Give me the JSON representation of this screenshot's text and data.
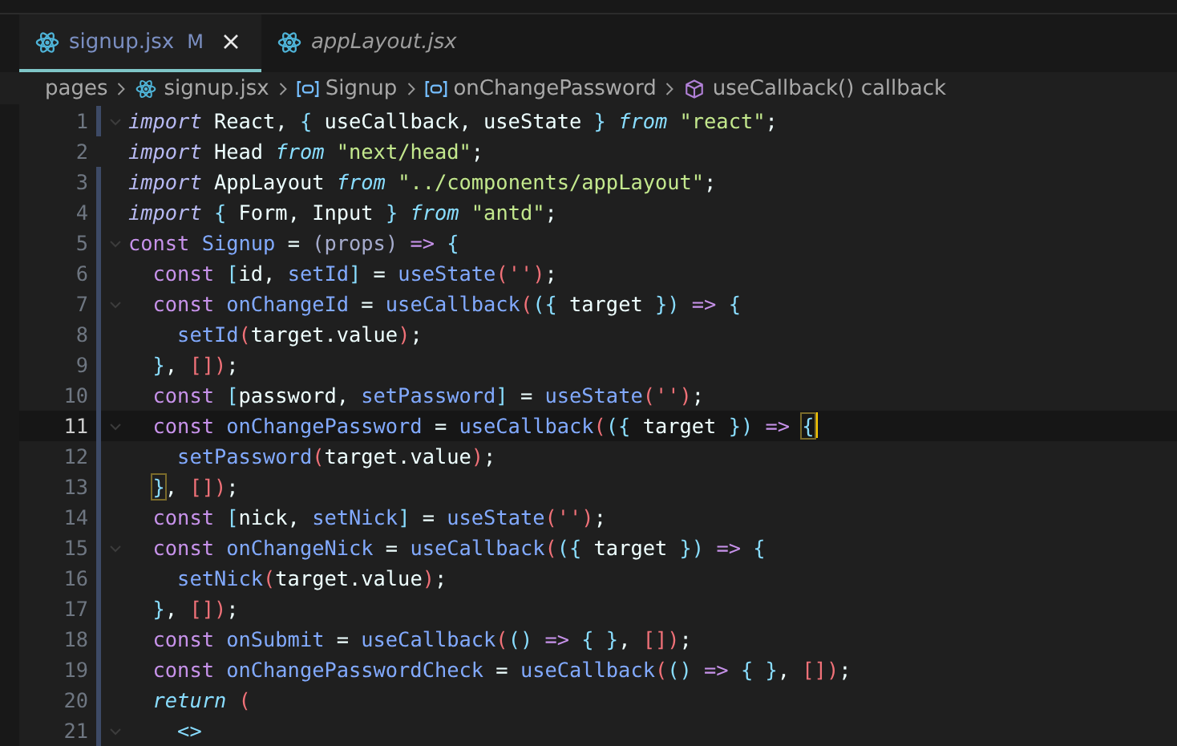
{
  "tabs": [
    {
      "label": "signup.jsx",
      "badge": "M",
      "selected": true,
      "preview": false
    },
    {
      "label": "appLayout.jsx",
      "selected": false,
      "preview": true
    }
  ],
  "breadcrumb": [
    {
      "kind": "folder",
      "label": "pages"
    },
    {
      "kind": "file",
      "label": "signup.jsx"
    },
    {
      "kind": "variable",
      "label": "Signup"
    },
    {
      "kind": "variable",
      "label": "onChangePassword"
    },
    {
      "kind": "method",
      "label": "useCallback() callback"
    }
  ],
  "lines": [
    {
      "number": "1",
      "current": false,
      "modified": true,
      "foldable": true,
      "cursor": false,
      "tokens": [
        {
          "kind": "module",
          "text": "import"
        },
        {
          "kind": "plain",
          "text": " React, "
        },
        {
          "kind": "b1",
          "text": "{"
        },
        {
          "kind": "plain",
          "text": " useCallback, useState "
        },
        {
          "kind": "b1",
          "text": "} "
        },
        {
          "kind": "control",
          "text": "from "
        },
        {
          "kind": "str",
          "text": "\"react\""
        },
        {
          "kind": "plain",
          "text": ";"
        }
      ]
    },
    {
      "number": "2",
      "current": false,
      "modified": false,
      "foldable": false,
      "cursor": false,
      "tokens": [
        {
          "kind": "module",
          "text": "import"
        },
        {
          "kind": "plain",
          "text": " Head "
        },
        {
          "kind": "control",
          "text": "from "
        },
        {
          "kind": "str",
          "text": "\"next/head\""
        },
        {
          "kind": "plain",
          "text": ";"
        }
      ]
    },
    {
      "number": "3",
      "current": false,
      "modified": true,
      "foldable": false,
      "cursor": false,
      "tokens": [
        {
          "kind": "module",
          "text": "import"
        },
        {
          "kind": "plain",
          "text": " AppLayout "
        },
        {
          "kind": "control",
          "text": "from "
        },
        {
          "kind": "str",
          "text": "\"../components/appLayout\""
        },
        {
          "kind": "plain",
          "text": ";"
        }
      ]
    },
    {
      "number": "4",
      "current": false,
      "modified": true,
      "foldable": false,
      "cursor": false,
      "tokens": [
        {
          "kind": "module",
          "text": "import "
        },
        {
          "kind": "b1",
          "text": "{"
        },
        {
          "kind": "plain",
          "text": " Form, Input "
        },
        {
          "kind": "b1",
          "text": "} "
        },
        {
          "kind": "control",
          "text": "from "
        },
        {
          "kind": "str",
          "text": "\"antd\""
        },
        {
          "kind": "plain",
          "text": ";"
        }
      ]
    },
    {
      "number": "5",
      "current": false,
      "modified": true,
      "foldable": true,
      "cursor": false,
      "tokens": [
        {
          "kind": "storage",
          "text": "const "
        },
        {
          "kind": "func",
          "text": "Signup"
        },
        {
          "kind": "plain",
          "text": " = "
        },
        {
          "kind": "param",
          "text": "(props) "
        },
        {
          "kind": "arrow",
          "text": "=> "
        },
        {
          "kind": "b1",
          "text": "{"
        }
      ]
    },
    {
      "number": "6",
      "current": false,
      "modified": true,
      "foldable": false,
      "cursor": false,
      "tokens": [
        {
          "kind": "storage",
          "text": "  const "
        },
        {
          "kind": "b1",
          "text": "["
        },
        {
          "kind": "plain",
          "text": "id, "
        },
        {
          "kind": "func",
          "text": "setId"
        },
        {
          "kind": "b1",
          "text": "]"
        },
        {
          "kind": "plain",
          "text": " = "
        },
        {
          "kind": "func",
          "text": "useState"
        },
        {
          "kind": "b2",
          "text": "('')"
        },
        {
          "kind": "plain",
          "text": ";"
        }
      ]
    },
    {
      "number": "7",
      "current": false,
      "modified": true,
      "foldable": true,
      "cursor": false,
      "tokens": [
        {
          "kind": "storage",
          "text": "  const "
        },
        {
          "kind": "func",
          "text": "onChangeId"
        },
        {
          "kind": "plain",
          "text": " = "
        },
        {
          "kind": "func",
          "text": "useCallback"
        },
        {
          "kind": "b2",
          "text": "("
        },
        {
          "kind": "b1",
          "text": "({"
        },
        {
          "kind": "plain",
          "text": " target "
        },
        {
          "kind": "b1",
          "text": "}) "
        },
        {
          "kind": "arrow",
          "text": "=> "
        },
        {
          "kind": "b1",
          "text": "{"
        }
      ]
    },
    {
      "number": "8",
      "current": false,
      "modified": true,
      "foldable": false,
      "cursor": false,
      "tokens": [
        {
          "kind": "func",
          "text": "    setId"
        },
        {
          "kind": "b2",
          "text": "("
        },
        {
          "kind": "plain",
          "text": "target.value"
        },
        {
          "kind": "b2",
          "text": ")"
        },
        {
          "kind": "plain",
          "text": ";"
        }
      ]
    },
    {
      "number": "9",
      "current": false,
      "modified": true,
      "foldable": false,
      "cursor": false,
      "tokens": [
        {
          "kind": "b1",
          "text": "  }"
        },
        {
          "kind": "plain",
          "text": ", "
        },
        {
          "kind": "b2",
          "text": "[])"
        },
        {
          "kind": "plain",
          "text": ";"
        }
      ]
    },
    {
      "number": "10",
      "current": false,
      "modified": true,
      "foldable": false,
      "cursor": false,
      "tokens": [
        {
          "kind": "storage",
          "text": "  const "
        },
        {
          "kind": "b1",
          "text": "["
        },
        {
          "kind": "plain",
          "text": "password, "
        },
        {
          "kind": "func",
          "text": "setPassword"
        },
        {
          "kind": "b1",
          "text": "]"
        },
        {
          "kind": "plain",
          "text": " = "
        },
        {
          "kind": "func",
          "text": "useState"
        },
        {
          "kind": "b2",
          "text": "('')"
        },
        {
          "kind": "plain",
          "text": ";"
        }
      ]
    },
    {
      "number": "11",
      "current": true,
      "modified": true,
      "foldable": true,
      "cursor": true,
      "tokens": [
        {
          "kind": "storage",
          "text": "  const "
        },
        {
          "kind": "func",
          "text": "onChangePassword"
        },
        {
          "kind": "plain",
          "text": " = "
        },
        {
          "kind": "func",
          "text": "useCallback"
        },
        {
          "kind": "b2",
          "text": "("
        },
        {
          "kind": "b1",
          "text": "({"
        },
        {
          "kind": "plain",
          "text": " target "
        },
        {
          "kind": "b1",
          "text": "}) "
        },
        {
          "kind": "arrow",
          "text": "=> "
        },
        {
          "kind": "match",
          "text": "{"
        }
      ]
    },
    {
      "number": "12",
      "current": false,
      "modified": true,
      "foldable": false,
      "cursor": false,
      "tokens": [
        {
          "kind": "func",
          "text": "    setPassword"
        },
        {
          "kind": "b2",
          "text": "("
        },
        {
          "kind": "plain",
          "text": "target.value"
        },
        {
          "kind": "b2",
          "text": ")"
        },
        {
          "kind": "plain",
          "text": ";"
        }
      ]
    },
    {
      "number": "13",
      "current": false,
      "modified": true,
      "foldable": false,
      "cursor": false,
      "tokens": [
        {
          "kind": "match",
          "text": "  }"
        },
        {
          "kind": "plain",
          "text": ", "
        },
        {
          "kind": "b2",
          "text": "[])"
        },
        {
          "kind": "plain",
          "text": ";"
        }
      ]
    },
    {
      "number": "14",
      "current": false,
      "modified": true,
      "foldable": false,
      "cursor": false,
      "tokens": [
        {
          "kind": "storage",
          "text": "  const "
        },
        {
          "kind": "b1",
          "text": "["
        },
        {
          "kind": "plain",
          "text": "nick, "
        },
        {
          "kind": "func",
          "text": "setNick"
        },
        {
          "kind": "b1",
          "text": "]"
        },
        {
          "kind": "plain",
          "text": " = "
        },
        {
          "kind": "func",
          "text": "useState"
        },
        {
          "kind": "b2",
          "text": "('')"
        },
        {
          "kind": "plain",
          "text": ";"
        }
      ]
    },
    {
      "number": "15",
      "current": false,
      "modified": true,
      "foldable": true,
      "cursor": false,
      "tokens": [
        {
          "kind": "storage",
          "text": "  const "
        },
        {
          "kind": "func",
          "text": "onChangeNick"
        },
        {
          "kind": "plain",
          "text": " = "
        },
        {
          "kind": "func",
          "text": "useCallback"
        },
        {
          "kind": "b2",
          "text": "("
        },
        {
          "kind": "b1",
          "text": "({"
        },
        {
          "kind": "plain",
          "text": " target "
        },
        {
          "kind": "b1",
          "text": "}) "
        },
        {
          "kind": "arrow",
          "text": "=> "
        },
        {
          "kind": "b1",
          "text": "{"
        }
      ]
    },
    {
      "number": "16",
      "current": false,
      "modified": true,
      "foldable": false,
      "cursor": false,
      "tokens": [
        {
          "kind": "func",
          "text": "    setNick"
        },
        {
          "kind": "b2",
          "text": "("
        },
        {
          "kind": "plain",
          "text": "target.value"
        },
        {
          "kind": "b2",
          "text": ")"
        },
        {
          "kind": "plain",
          "text": ";"
        }
      ]
    },
    {
      "number": "17",
      "current": false,
      "modified": true,
      "foldable": false,
      "cursor": false,
      "tokens": [
        {
          "kind": "b1",
          "text": "  }"
        },
        {
          "kind": "plain",
          "text": ", "
        },
        {
          "kind": "b2",
          "text": "[])"
        },
        {
          "kind": "plain",
          "text": ";"
        }
      ]
    },
    {
      "number": "18",
      "current": false,
      "modified": true,
      "foldable": false,
      "cursor": false,
      "tokens": [
        {
          "kind": "storage",
          "text": "  const "
        },
        {
          "kind": "func",
          "text": "onSubmit"
        },
        {
          "kind": "plain",
          "text": " = "
        },
        {
          "kind": "func",
          "text": "useCallback"
        },
        {
          "kind": "b2",
          "text": "("
        },
        {
          "kind": "b1",
          "text": "() "
        },
        {
          "kind": "arrow",
          "text": "=> "
        },
        {
          "kind": "b1",
          "text": "{ }"
        },
        {
          "kind": "plain",
          "text": ", "
        },
        {
          "kind": "b2",
          "text": "[])"
        },
        {
          "kind": "plain",
          "text": ";"
        }
      ]
    },
    {
      "number": "19",
      "current": false,
      "modified": true,
      "foldable": false,
      "cursor": false,
      "tokens": [
        {
          "kind": "storage",
          "text": "  const "
        },
        {
          "kind": "func",
          "text": "onChangePasswordCheck"
        },
        {
          "kind": "plain",
          "text": " = "
        },
        {
          "kind": "func",
          "text": "useCallback"
        },
        {
          "kind": "b2",
          "text": "("
        },
        {
          "kind": "b1",
          "text": "() "
        },
        {
          "kind": "arrow",
          "text": "=> "
        },
        {
          "kind": "b1",
          "text": "{ }"
        },
        {
          "kind": "plain",
          "text": ", "
        },
        {
          "kind": "b2",
          "text": "[])"
        },
        {
          "kind": "plain",
          "text": ";"
        }
      ]
    },
    {
      "number": "20",
      "current": false,
      "modified": true,
      "foldable": false,
      "cursor": false,
      "tokens": [
        {
          "kind": "control",
          "text": "  return "
        },
        {
          "kind": "b2",
          "text": "("
        }
      ]
    },
    {
      "number": "21",
      "current": false,
      "modified": true,
      "foldable": true,
      "cursor": false,
      "tokens": [
        {
          "kind": "b1",
          "text": "    <>"
        }
      ]
    }
  ]
}
